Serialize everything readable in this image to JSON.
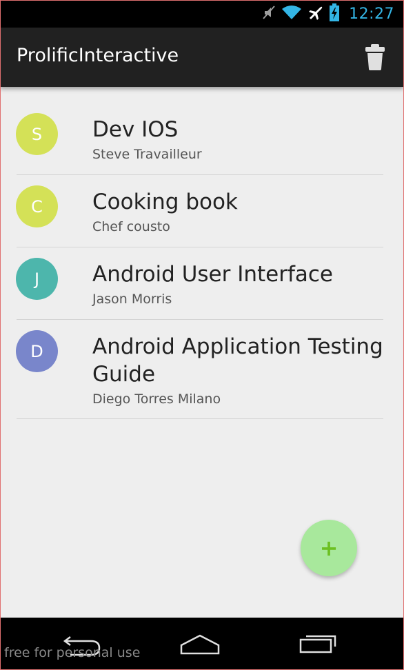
{
  "status_bar": {
    "time": "12:27",
    "icons": [
      "mute-icon",
      "wifi-icon",
      "airplane-icon",
      "battery-charging-icon"
    ],
    "accent_color": "#33b5e5"
  },
  "app_bar": {
    "title": "ProlificInteractive",
    "action_icon": "trash-icon"
  },
  "list": {
    "items": [
      {
        "initial": "S",
        "title": "Dev IOS",
        "subtitle": "Steve Travailleur",
        "avatar_color": "#d4e157"
      },
      {
        "initial": "C",
        "title": "Cooking book",
        "subtitle": "Chef cousto",
        "avatar_color": "#d4e157"
      },
      {
        "initial": "J",
        "title": "Android User Interface",
        "subtitle": "Jason Morris",
        "avatar_color": "#4db6ac"
      },
      {
        "initial": "D",
        "title": "Android Application Testing Guide",
        "subtitle": "Diego Torres Milano",
        "avatar_color": "#7986cb"
      }
    ]
  },
  "fab": {
    "label": "+",
    "icon": "plus-icon",
    "color": "#a8e89c"
  },
  "nav_bar": {
    "buttons": [
      "back-icon",
      "home-icon",
      "recent-apps-icon"
    ]
  },
  "watermark": {
    "text": "free for personal use"
  }
}
